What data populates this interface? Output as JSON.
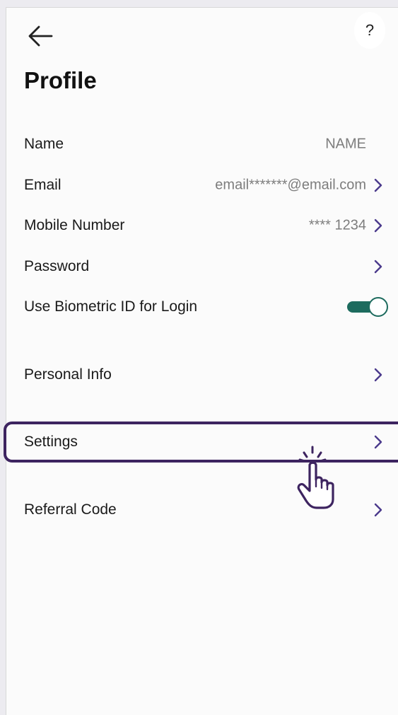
{
  "header": {
    "back_icon": "arrow-left-icon",
    "help_label": "?"
  },
  "page": {
    "title": "Profile"
  },
  "rows": {
    "name": {
      "label": "Name",
      "value": "NAME"
    },
    "email": {
      "label": "Email",
      "value": "email*******@email.com"
    },
    "mobile": {
      "label": "Mobile Number",
      "value": "**** 1234"
    },
    "password": {
      "label": "Password"
    },
    "biometric": {
      "label": "Use Biometric ID for Login",
      "enabled": true
    },
    "personal_info": {
      "label": "Personal Info"
    },
    "settings": {
      "label": "Settings",
      "highlighted": true
    },
    "referral": {
      "label": "Referral Code"
    }
  },
  "overlay": {
    "pointer_icon": "tap-hand-icon"
  },
  "colors": {
    "accent": "#4b3a8c",
    "toggle_on": "#1d6b5e",
    "highlight_border": "#3d2460",
    "text_primary": "#1a1a1a",
    "text_secondary": "#7d7d7d"
  }
}
